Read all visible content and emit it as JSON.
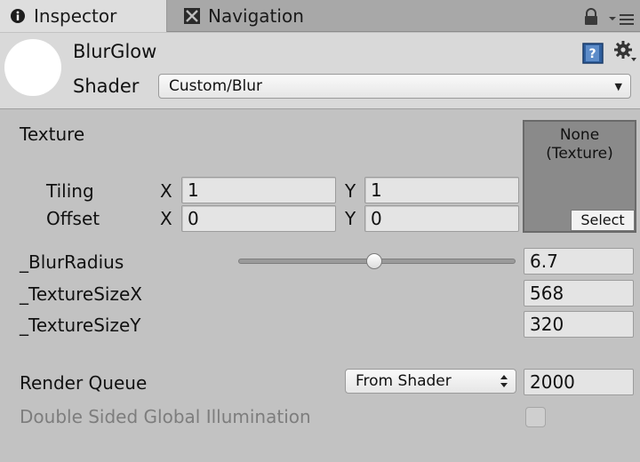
{
  "tabs": [
    {
      "label": "Inspector",
      "icon": "info-icon",
      "active": true
    },
    {
      "label": "Navigation",
      "icon": "navigation-icon",
      "active": false
    }
  ],
  "header": {
    "material_name": "BlurGlow",
    "shader_label": "Shader",
    "shader_value": "Custom/Blur"
  },
  "texture": {
    "label": "Texture",
    "slot_text": "None\n(Texture)",
    "select_label": "Select",
    "tiling_label": "Tiling",
    "offset_label": "Offset",
    "x_label": "X",
    "y_label": "Y",
    "tiling_x": "1",
    "tiling_y": "1",
    "offset_x": "0",
    "offset_y": "0"
  },
  "properties": {
    "blur_radius_label": "_BlurRadius",
    "blur_radius_value": "6.7",
    "blur_radius_fraction": 0.49,
    "texture_size_x_label": "_TextureSizeX",
    "texture_size_x_value": "568",
    "texture_size_y_label": "_TextureSizeY",
    "texture_size_y_value": "320"
  },
  "render_queue": {
    "label": "Render Queue",
    "dropdown_value": "From Shader",
    "value": "2000"
  },
  "dsgi": {
    "label": "Double Sided Global Illumination",
    "checked": false
  },
  "colors": {
    "background": "#c2c2c2",
    "header": "#d9d9d9",
    "texture_slot": "#8a8a8a",
    "help_icon": "#3b6fb3"
  }
}
